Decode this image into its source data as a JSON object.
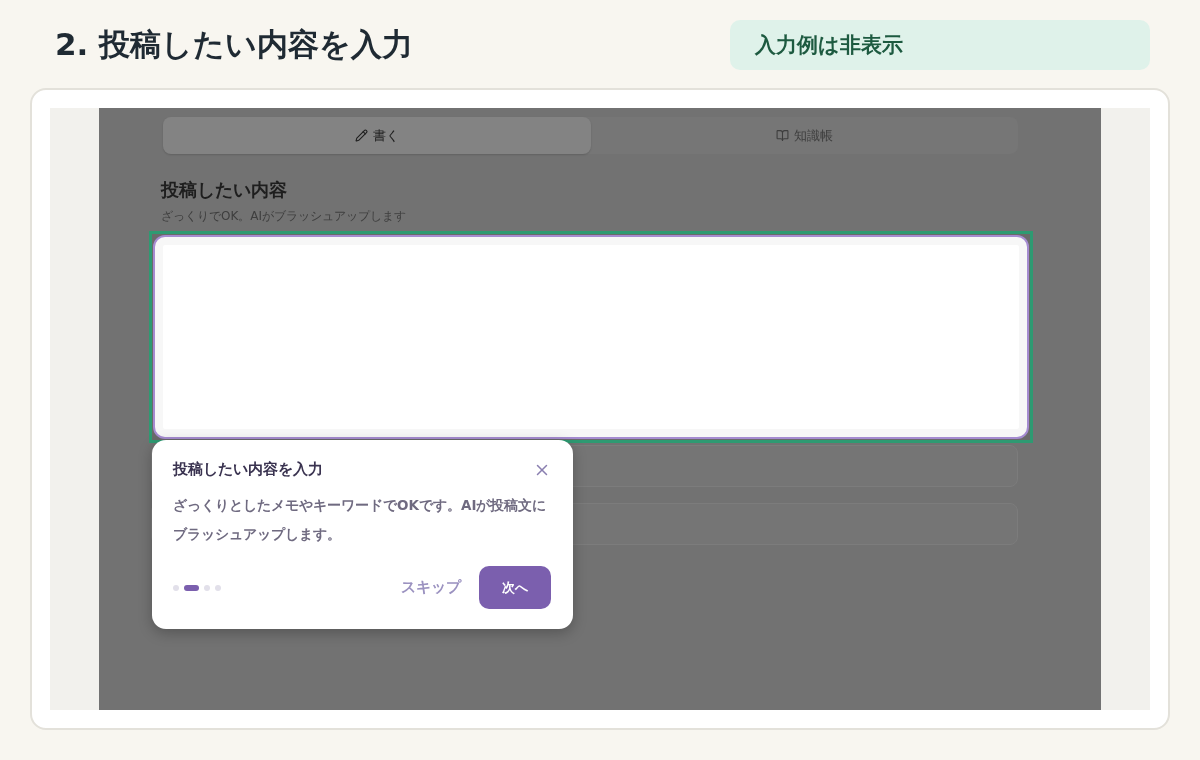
{
  "page_title": "2. 投稿したい内容を入力",
  "example_toggle": {
    "label": "入力例は非表示"
  },
  "preview": {
    "tabs": [
      {
        "label": "書く",
        "kind": "write",
        "selected": true
      },
      {
        "label": "知識帳",
        "kind": "knowledge",
        "selected": false
      }
    ],
    "section_title": "投稿したい内容",
    "section_hint": "ざっくりでOK。AIがブラッシュアップします",
    "tour": {
      "title": "投稿したい内容を入力",
      "body": "ざっくりとしたメモやキーワードでOKです。AIが投稿文にブラッシュアップします。",
      "steps": [
        {
          "selected": false
        },
        {
          "selected": true
        },
        {
          "selected": false
        },
        {
          "selected": false
        }
      ],
      "skip": "スキップ",
      "next": "次へ"
    }
  }
}
